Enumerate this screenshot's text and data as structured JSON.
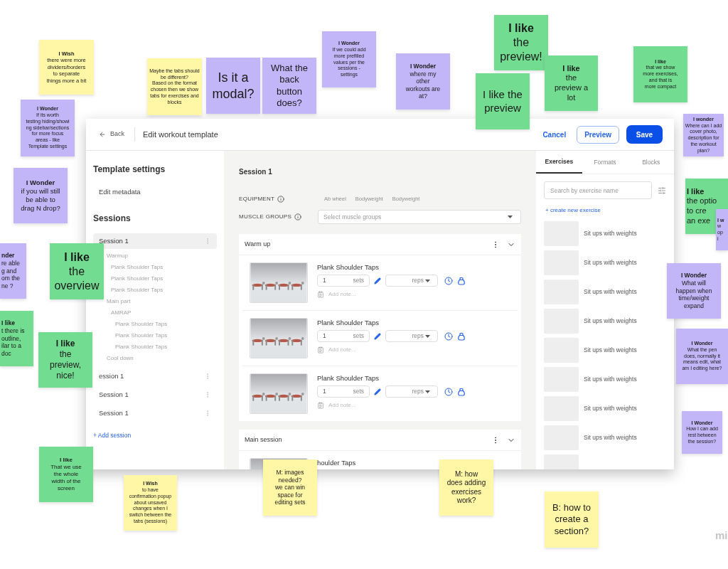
{
  "notes": [
    {
      "title": "I Wish",
      "body": "there were more\ndividers/borders\nto separate\nthings more a bit",
      "color": "#fff6a6"
    },
    {
      "title": "I Wonder",
      "body": "If its worth\ntesting hiding/showi\nng sidebar/sections\nfor more focus\nareas - like\nTemplate settings",
      "color": "#c2b6f8"
    },
    {
      "title": "I Wonder",
      "body": "if you will still\nbe able to\ndrag N drop?",
      "color": "#c2b6f8"
    },
    {
      "body": "Maybe the tabs should\nbe different?\nBased on the format\nchosen then we show\ntabs for exercises and\nblocks",
      "color": "#fff6a6"
    },
    {
      "body": "Is it a\nmodal?",
      "color": "#c2b6f8"
    },
    {
      "body": "What the\nback\nbutton\ndoes?",
      "color": "#c2b6f8"
    },
    {
      "title": "I Wonder",
      "body": "If we could add\nmore prefilled\nvalues per the\nsessions -\nsettings",
      "color": "#c2b6f8"
    },
    {
      "title": "I Wonder",
      "body": "where my\nother\nworkouts are\nat?",
      "color": "#c2b6f8"
    },
    {
      "title": "I like",
      "body": "the\npreview!",
      "color": "#72dc91"
    },
    {
      "body": "I like the\npreview",
      "color": "#72dc91"
    },
    {
      "title": "I like",
      "body": "the\npreview a\nlot",
      "color": "#72dc91"
    },
    {
      "title": "I like",
      "body": "that we show\nmore exercises,\nand that is\nmore compact",
      "color": "#72dc91"
    },
    {
      "title": "I wonder",
      "body": "Where can I add\ncover photo,\ndescription for\nthe workout\nplan?",
      "color": "#c2b6f8"
    },
    {
      "title": "I like",
      "body": "the optio\nto cre\nan exe",
      "color": "#72dc91"
    },
    {
      "title": "I w",
      "body": "w\nop\ni",
      "color": "#c2b6f8"
    },
    {
      "title": "I Wonder",
      "body": "What will\nhappen when\ntime/weight\nexpand",
      "color": "#c2b6f8"
    },
    {
      "title": "I Wonder",
      "body": "What the pen\ndoes, normally it\nmeans edit, what\nam I editing here?",
      "color": "#c2b6f8"
    },
    {
      "title": "I Wonder",
      "body": "How I can add\nrest between\nthe session?",
      "color": "#c2b6f8"
    },
    {
      "title": "nder",
      "body": "re able\ng and\nom the\nne ?",
      "color": "#c2b6f8"
    },
    {
      "title": "I like",
      "body": "the\noverview",
      "color": "#72dc91"
    },
    {
      "title": "I like",
      "body": "t there is\noutline,\nilar to a\ndoc",
      "color": "#72dc91"
    },
    {
      "title": "I like",
      "body": "the\npreview,\nnice!",
      "color": "#72dc91"
    },
    {
      "title": "I like",
      "body": "That we use\nthe whole\nwidth of the\nscreen",
      "color": "#72dc91"
    },
    {
      "title": "I Wish",
      "body": "to have\nconfirmation popup\nabout unsaved\nchanges when I\nswitch between the\ntabs (sessions)",
      "color": "#fff6a6"
    },
    {
      "body": "M: images\nneeded?\nwe can win\nspace for\nediting sets",
      "color": "#fff6a6"
    },
    {
      "body": "M: how\ndoes adding\nexercises\nwork?",
      "color": "#fff6a6"
    },
    {
      "body": "B: how to\ncreate a\nsection?",
      "color": "#fff6a6"
    }
  ],
  "app": {
    "header": {
      "back": "Back",
      "title": "Edit workout template",
      "cancel": "Cancel",
      "preview": "Preview",
      "save": "Save"
    },
    "sidebar": {
      "settings_heading": "Template settings",
      "settings_items": [
        "Edit metadata"
      ],
      "sessions_heading": "Sessions",
      "sessions": [
        {
          "name": "Session 1",
          "selected": true,
          "children": [
            {
              "label": "Warmup",
              "children": [
                {
                  "label": "Plank Shoulder Taps"
                },
                {
                  "label": "Plank Shoulder Taps"
                },
                {
                  "label": "Plank Shoulder Taps"
                }
              ]
            },
            {
              "label": "Main part",
              "children": [
                {
                  "label": "AMRAP",
                  "children": [
                    {
                      "label": "Plank Shoulder Taps"
                    },
                    {
                      "label": "Plank Shoulder Taps"
                    },
                    {
                      "label": "Plank Shoulder Taps"
                    }
                  ]
                }
              ]
            },
            {
              "label": "Cool down"
            }
          ]
        },
        {
          "name": "ession 1",
          "selected": false
        },
        {
          "name": "Session 1",
          "selected": false
        },
        {
          "name": "Session 1",
          "selected": false
        }
      ],
      "add_session": "+ Add session"
    },
    "main": {
      "title": "Session 1",
      "equipment": {
        "label": "EQUIPMENT",
        "options": [
          "Ab wheel",
          "Bodyweight",
          "Bodyweight"
        ]
      },
      "muscle_groups": {
        "label": "MUSCLE GROUPS",
        "placeholder": "Select muscle groups"
      },
      "sections": [
        {
          "title": "Warm up",
          "exercises": [
            {
              "name": "Plank Shoulder Taps",
              "sets": "1",
              "sets_unit": "sets",
              "reps_unit": "reps",
              "note_placeholder": "Add note..."
            },
            {
              "name": "Plank Shoulder Taps",
              "sets": "1",
              "sets_unit": "sets",
              "reps_unit": "reps",
              "note_placeholder": "Add note..."
            },
            {
              "name": "Plank Shoulder Taps",
              "sets": "1",
              "sets_unit": "sets",
              "reps_unit": "reps",
              "note_placeholder": "Add note..."
            }
          ]
        },
        {
          "title": "Main session",
          "exercises": [
            {
              "name": "houlder Taps"
            }
          ]
        }
      ]
    },
    "library": {
      "tabs": [
        {
          "label": "Exercises",
          "selected": true
        },
        {
          "label": "Formats",
          "selected": false
        },
        {
          "label": "Blocks",
          "selected": false
        }
      ],
      "search_placeholder": "Search by exercise name",
      "create_link": "+ create new exercise",
      "items": [
        "Sit ups with weights",
        "Sit ups with weights",
        "Sit ups with weights",
        "Sit ups with weights",
        "Sit ups with weights",
        "Sit ups with weights",
        "Sit ups with weights",
        "Sit ups with weights"
      ]
    }
  },
  "logo": "mi"
}
